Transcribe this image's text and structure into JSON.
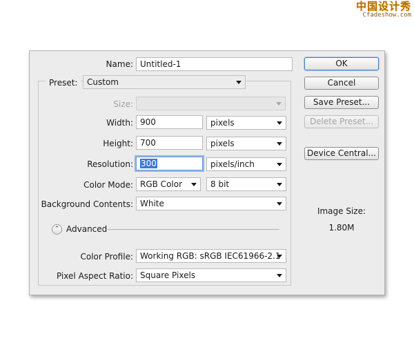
{
  "watermark": {
    "line1": "中国设计秀",
    "line2": "Cfadeshow.com"
  },
  "dialog": {
    "name": {
      "label": "Name:",
      "value": "Untitled-1"
    },
    "preset": {
      "label": "Preset:",
      "value": "Custom"
    },
    "size": {
      "label": "Size:",
      "value": ""
    },
    "width": {
      "label": "Width:",
      "value": "900",
      "unit": "pixels"
    },
    "height": {
      "label": "Height:",
      "value": "700",
      "unit": "pixels"
    },
    "resolution": {
      "label": "Resolution:",
      "value": "300",
      "unit": "pixels/inch"
    },
    "color_mode": {
      "label": "Color Mode:",
      "value": "RGB Color",
      "bit_depth": "8 bit"
    },
    "background": {
      "label": "Background Contents:",
      "value": "White"
    },
    "advanced": {
      "label": "Advanced",
      "icon": "chevron-up-double-icon"
    },
    "color_profile": {
      "label": "Color Profile:",
      "value": "Working RGB:  sRGB IEC61966-2.1"
    },
    "pixel_aspect": {
      "label": "Pixel Aspect Ratio:",
      "value": "Square Pixels"
    },
    "buttons": {
      "ok": "OK",
      "cancel": "Cancel",
      "save_preset": "Save Preset...",
      "delete_preset": "Delete Preset...",
      "device_central": "Device Central..."
    },
    "image_size": {
      "label": "Image Size:",
      "value": "1.80M"
    }
  },
  "colors": {
    "dialog_bg": "#ececec",
    "selection": "#3b78d9",
    "default_button_border": "#4f7fc0"
  }
}
